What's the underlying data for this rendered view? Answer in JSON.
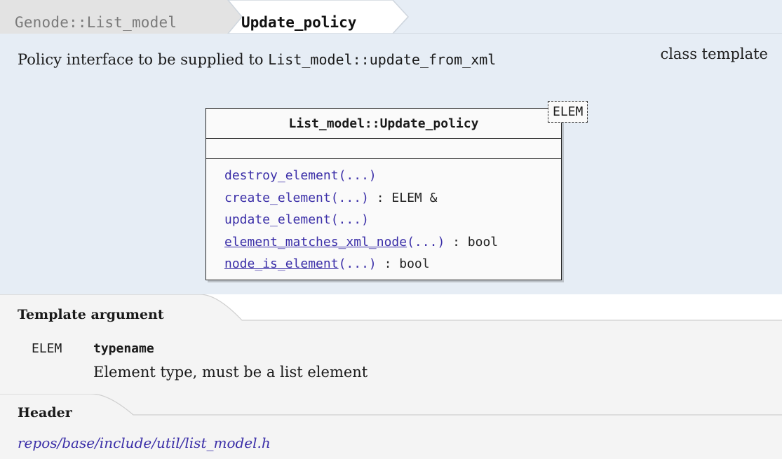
{
  "breadcrumb": {
    "parent": "Genode::List_model",
    "current": "Update_policy"
  },
  "description": {
    "text": "Policy interface to be supplied to",
    "code": "List_model::update_from_xml"
  },
  "kind": "class template",
  "class_diagram": {
    "name": "List_model::Update_policy",
    "template_param": "ELEM",
    "methods": [
      {
        "name": "destroy_element",
        "args": "(...)",
        "ret": "",
        "linked": false
      },
      {
        "name": "create_element",
        "args": "(...)",
        "ret": " : ELEM &",
        "linked": false
      },
      {
        "name": "update_element",
        "args": "(...)",
        "ret": "",
        "linked": false
      },
      {
        "name": "element_matches_xml_node",
        "args": "(...)",
        "ret": " : bool",
        "linked": true
      },
      {
        "name": "node_is_element",
        "args": "(...)",
        "ret": " : bool",
        "linked": true
      }
    ]
  },
  "template_argument": {
    "section_title": "Template argument",
    "name": "ELEM",
    "type": "typename",
    "description": "Element type, must be a list element"
  },
  "header": {
    "section_title": "Header",
    "path": "repos/base/include/util/list_model.h"
  },
  "colors": {
    "band": "#e6edf5",
    "section": "#f4f4f4",
    "link": "#3b2fa8"
  }
}
